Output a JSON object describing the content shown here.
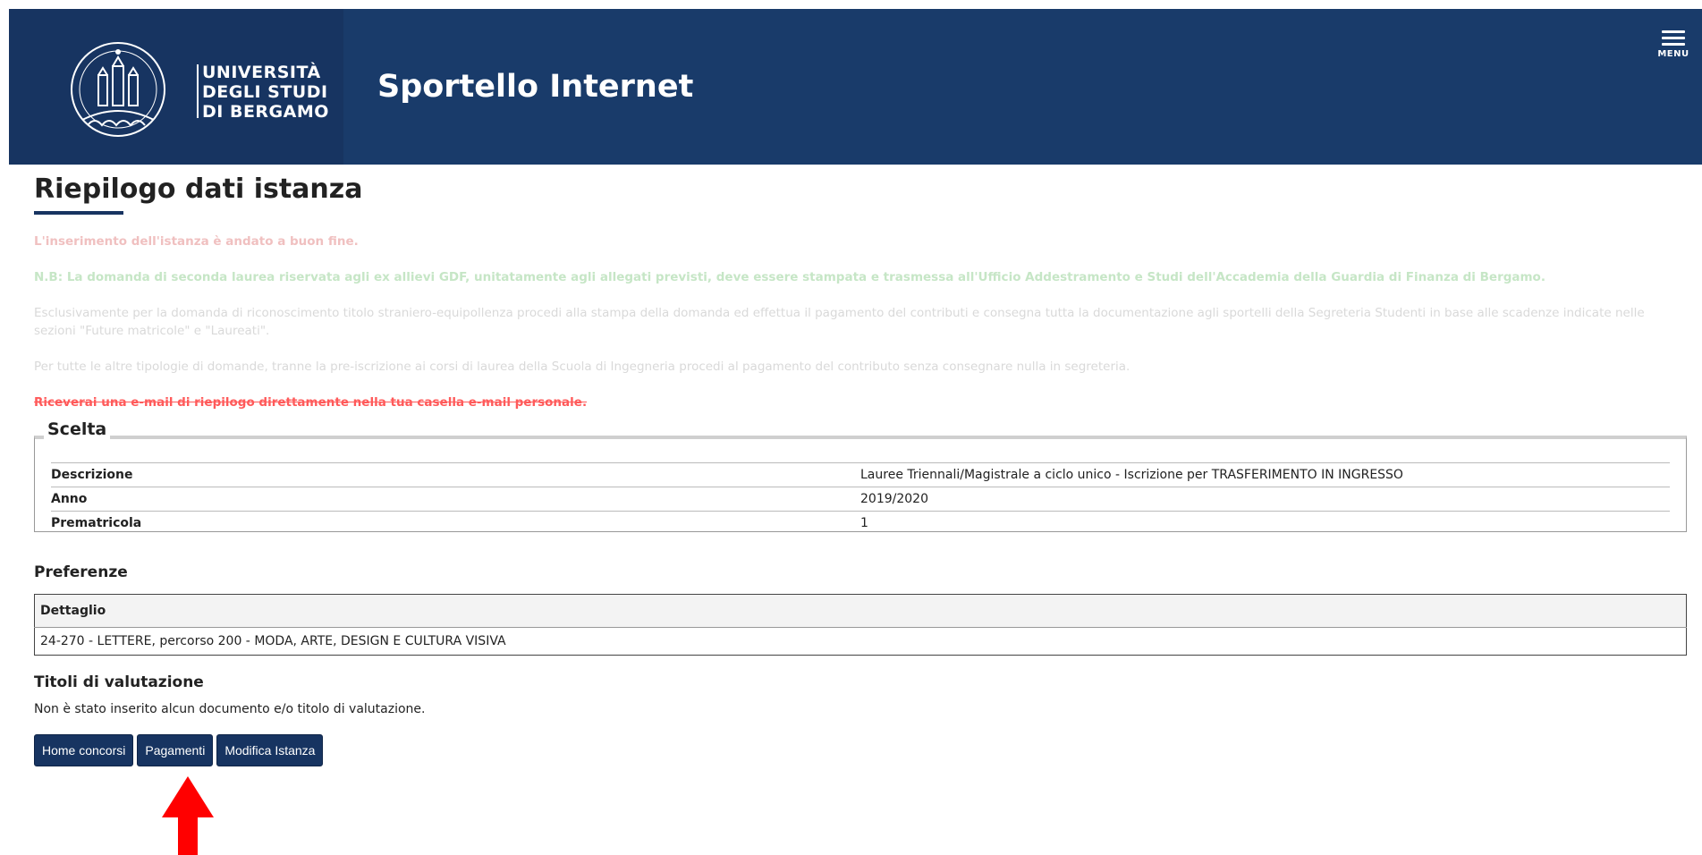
{
  "header": {
    "logo_text": "UNIVERSITÀ\nDEGLI STUDI\nDI BERGAMO",
    "site_title": "Sportello Internet",
    "menu_label": "MENU",
    "bg_color": "#193b6a"
  },
  "page": {
    "title": "Riepilogo dati istanza"
  },
  "messages": {
    "success": "L'inserimento dell'istanza è andato a buon fine.",
    "nb": "N.B: La domanda di seconda laurea riservata agli ex allievi GDF, unitatamente agli allegati previsti, deve essere stampata e trasmessa all'Ufficio Addestramento e Studi dell'Accademia della Guardia di Finanza di Bergamo.",
    "info1": "Esclusivamente per la domanda di riconoscimento titolo straniero-equipollenza procedi alla stampa della domanda ed effettua il pagamento del contributi e consegna tutta la documentazione agli sportelli della Segreteria Studenti in base alle scadenze indicate nelle sezioni \"Future matricole\" e \"Laureati\".",
    "info2": "Per tutte le altre tipologie di domande, tranne la pre-iscrizione ai corsi di laurea della Scuola di Ingegneria procedi al pagamento del contributo senza consegnare nulla in segreteria.",
    "email": "Riceverai una e-mail di riepilogo direttamente nella tua casella e-mail personale."
  },
  "scelta": {
    "legend": "Scelta",
    "rows": [
      {
        "label": "Descrizione",
        "value": "Lauree Triennali/Magistrale a ciclo unico - Iscrizione per TRASFERIMENTO IN INGRESSO"
      },
      {
        "label": "Anno",
        "value": "2019/2020"
      },
      {
        "label": "Prematricola",
        "value": "1"
      }
    ]
  },
  "preferenze": {
    "heading": "Preferenze",
    "column": "Dettaglio",
    "rows": [
      "24-270 - LETTERE, percorso 200 - MODA, ARTE, DESIGN E CULTURA VISIVA"
    ]
  },
  "titoli": {
    "heading": "Titoli di valutazione",
    "empty_text": "Non è stato inserito alcun documento e/o titolo di valutazione."
  },
  "buttons": {
    "home": "Home concorsi",
    "pagamenti": "Pagamenti",
    "modifica": "Modifica Istanza"
  },
  "annotation": {
    "arrow_color": "#ff0000",
    "arrow_icon": "up-arrow-icon"
  }
}
